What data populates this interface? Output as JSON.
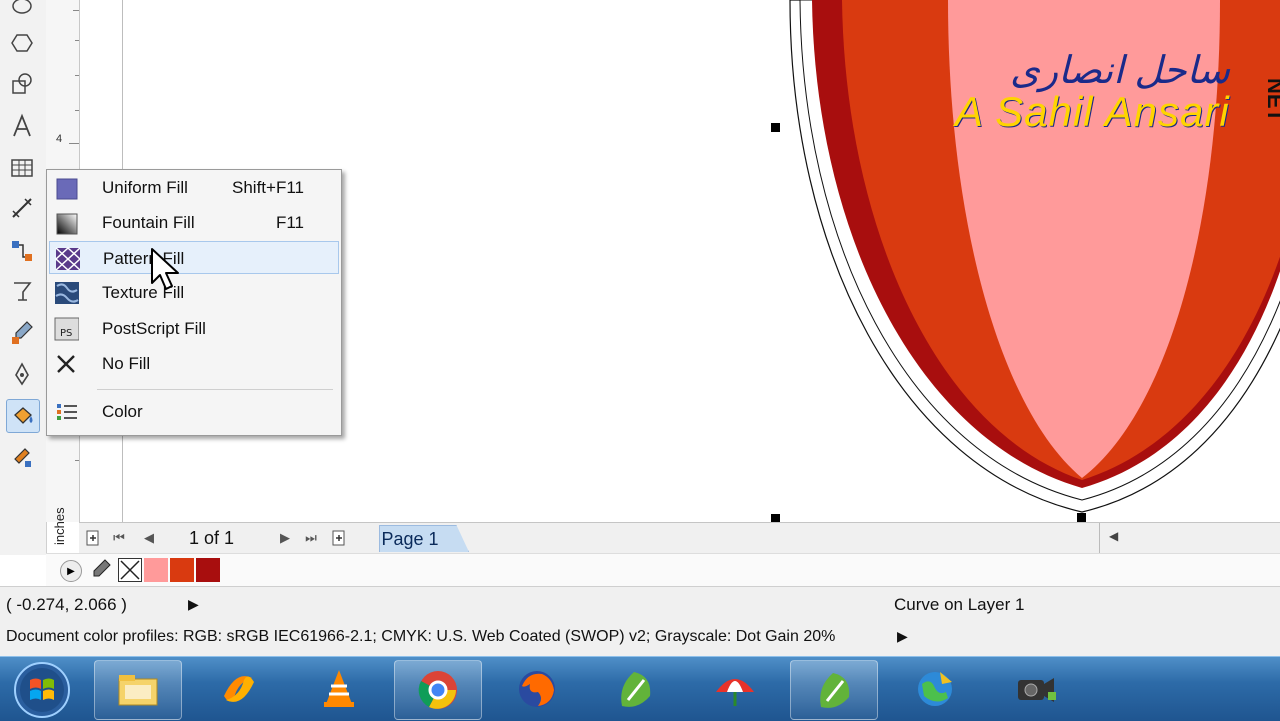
{
  "fill_menu": {
    "items": [
      {
        "label": "Uniform Fill",
        "shortcut": "Shift+F11"
      },
      {
        "label": "Fountain Fill",
        "shortcut": "F11"
      },
      {
        "label": "Pattern Fill",
        "shortcut": ""
      },
      {
        "label": "Texture Fill",
        "shortcut": ""
      },
      {
        "label": "PostScript Fill",
        "shortcut": ""
      },
      {
        "label": "No Fill",
        "shortcut": ""
      },
      {
        "label": "Color",
        "shortcut": ""
      }
    ]
  },
  "ruler": {
    "unit": "inches",
    "mark": "4"
  },
  "page_nav": {
    "count": "1 of 1",
    "tab": "Page 1"
  },
  "palette": {
    "colors": [
      "#ff9a9a",
      "#d93a10",
      "#a80e0e"
    ]
  },
  "status": {
    "coords": "( -0.274, 2.066 )",
    "object": "Curve on Layer 1",
    "profiles": "Document color profiles: RGB: sRGB IEC61966-2.1; CMYK: U.S. Web Coated (SWOP) v2; Grayscale: Dot Gain 20%"
  },
  "watermark": {
    "arabic": "ساحل انصاری",
    "latin": "A Sahil Ansari",
    "suffix": "NET"
  },
  "colors": {
    "light_red": "#ff9a9a",
    "red": "#d93a10",
    "dark_red": "#a80e0e",
    "taskbar": "#2d6ba8"
  },
  "taskbar": {
    "icons": [
      "start-orb",
      "file-explorer-icon",
      "app-swirl-icon",
      "vlc-icon",
      "chrome-icon",
      "firefox-icon",
      "coreldraw-icon",
      "app-umbrella-icon",
      "coreldraw-icon",
      "globe-icon",
      "camera-icon"
    ]
  }
}
